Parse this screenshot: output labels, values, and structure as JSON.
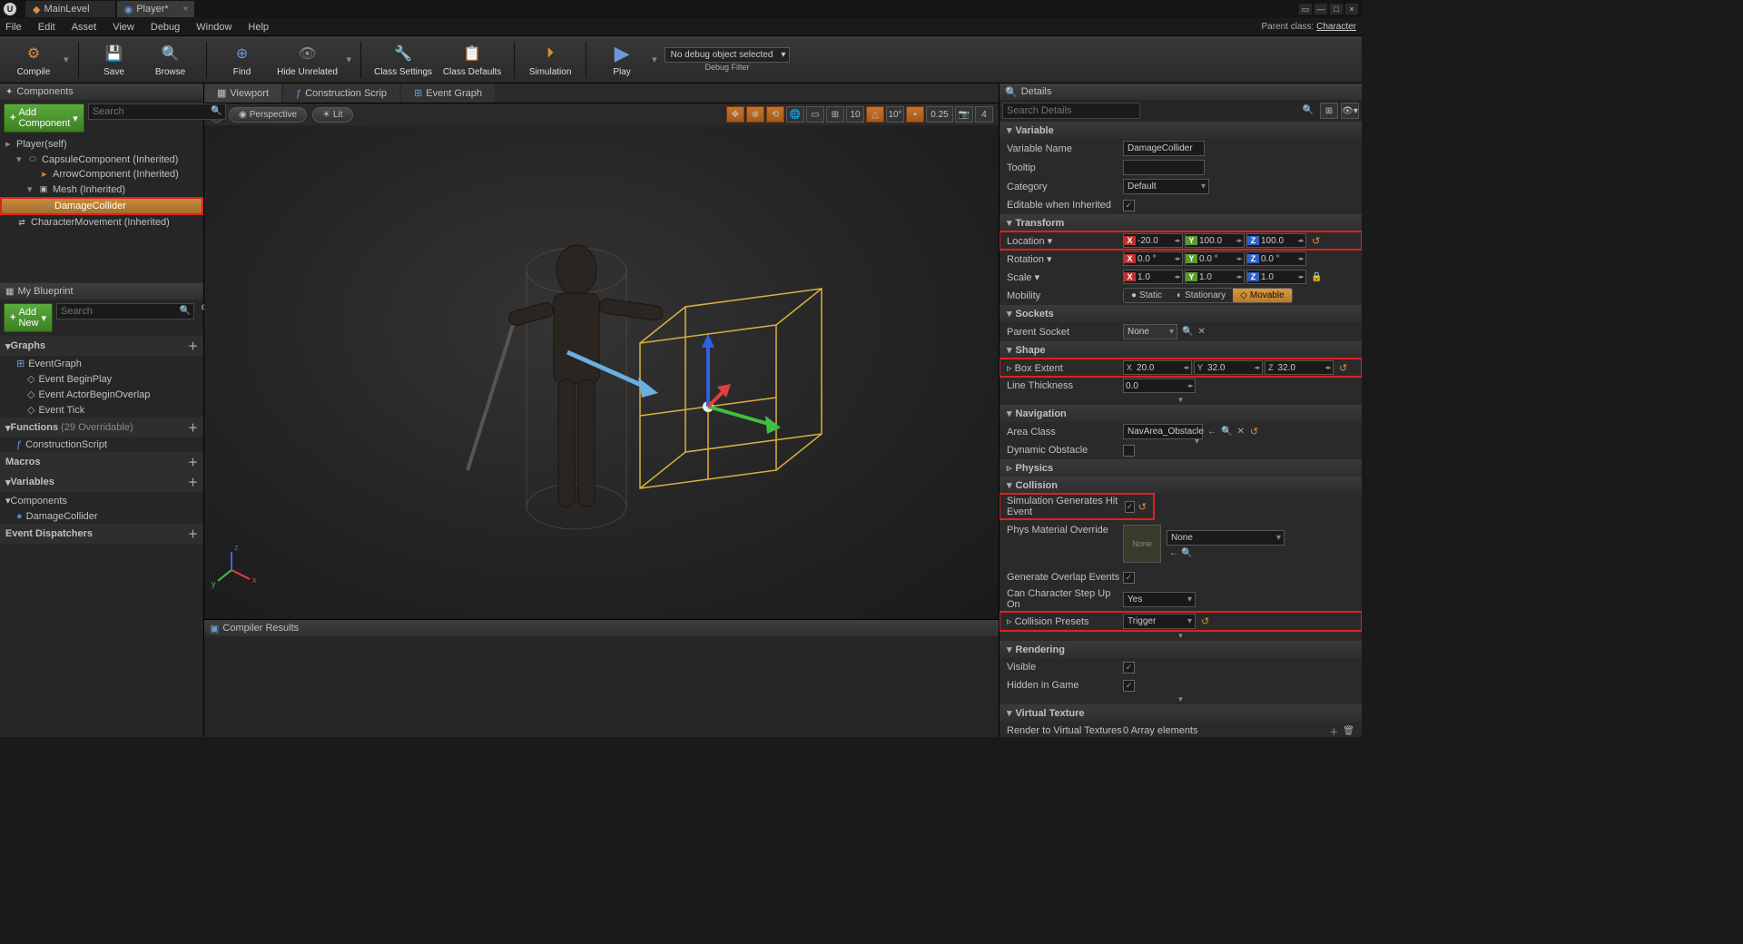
{
  "titlebar": {
    "tabs": [
      {
        "label": "MainLevel",
        "active": false
      },
      {
        "label": "Player*",
        "active": true
      }
    ]
  },
  "menubar": {
    "items": [
      "File",
      "Edit",
      "Asset",
      "View",
      "Debug",
      "Window",
      "Help"
    ],
    "parentClassLabel": "Parent class:",
    "parentClass": "Character"
  },
  "toolbar": {
    "compile": "Compile",
    "save": "Save",
    "browse": "Browse",
    "find": "Find",
    "hideUnrelated": "Hide Unrelated",
    "classSettings": "Class Settings",
    "classDefaults": "Class Defaults",
    "simulation": "Simulation",
    "play": "Play",
    "debugCombo": "No debug object selected",
    "debugFilter": "Debug Filter"
  },
  "components": {
    "title": "Components",
    "addBtn": "Add Component",
    "searchPlaceholder": "Search",
    "root": "Player(self)",
    "items": [
      {
        "label": "CapsuleComponent (Inherited)",
        "indent": 1,
        "caret": "▾",
        "ico": "pill-cyan"
      },
      {
        "label": "ArrowComponent (Inherited)",
        "indent": 2,
        "caret": "",
        "ico": "pill-orange"
      },
      {
        "label": "Mesh (Inherited)",
        "indent": 2,
        "caret": "▾",
        "ico": ""
      },
      {
        "label": "DamageCollider",
        "indent": 3,
        "caret": "",
        "ico": "",
        "selected": true,
        "red": true
      },
      {
        "label": "CharacterMovement (Inherited)",
        "indent": 1,
        "caret": "",
        "ico": ""
      }
    ]
  },
  "myBlueprint": {
    "title": "My Blueprint",
    "addNew": "Add New",
    "searchPlaceholder": "Search",
    "graphs": {
      "label": "Graphs"
    },
    "eventGraph": "EventGraph",
    "events": [
      "Event BeginPlay",
      "Event ActorBeginOverlap",
      "Event Tick"
    ],
    "functions": {
      "label": "Functions",
      "hint": "(29 Overridable)"
    },
    "constructionScript": "ConstructionScript",
    "macros": "Macros",
    "variables": "Variables",
    "componentsSection": "Components",
    "damageCollider": "DamageCollider",
    "eventDispatchers": "Event Dispatchers"
  },
  "centerTabs": {
    "viewport": "Viewport",
    "construction": "Construction Scrip",
    "eventGraph": "Event Graph"
  },
  "viewportBar": {
    "perspective": "Perspective",
    "lit": "Lit",
    "grid": "10",
    "angle": "10°",
    "scale": "0.25",
    "cam": "4"
  },
  "compiler": {
    "title": "Compiler Results"
  },
  "details": {
    "title": "Details",
    "searchPlaceholder": "Search Details",
    "variable": {
      "section": "Variable",
      "name": {
        "label": "Variable Name",
        "value": "DamageCollider"
      },
      "tooltip": {
        "label": "Tooltip",
        "value": ""
      },
      "category": {
        "label": "Category",
        "value": "Default"
      },
      "editable": {
        "label": "Editable when Inherited",
        "checked": true
      }
    },
    "transform": {
      "section": "Transform",
      "location": {
        "label": "Location",
        "x": "-20.0",
        "y": "100.0",
        "z": "100.0"
      },
      "rotation": {
        "label": "Rotation",
        "x": "0.0 °",
        "y": "0.0 °",
        "z": "0.0 °"
      },
      "scale": {
        "label": "Scale",
        "x": "1.0",
        "y": "1.0",
        "z": "1.0"
      },
      "mobility": {
        "label": "Mobility",
        "static": "Static",
        "stationary": "Stationary",
        "movable": "Movable"
      }
    },
    "sockets": {
      "section": "Sockets",
      "parentSocket": {
        "label": "Parent Socket",
        "value": "None"
      }
    },
    "shape": {
      "section": "Shape",
      "boxExtent": {
        "label": "Box Extent",
        "x": "20.0",
        "y": "32.0",
        "z": "32.0"
      },
      "lineThickness": {
        "label": "Line Thickness",
        "value": "0.0"
      }
    },
    "navigation": {
      "section": "Navigation",
      "areaClass": {
        "label": "Area Class",
        "value": "NavArea_Obstacle"
      },
      "dynamic": {
        "label": "Dynamic Obstacle",
        "checked": false
      }
    },
    "physics": {
      "section": "Physics"
    },
    "collision": {
      "section": "Collision",
      "simHit": {
        "label": "Simulation Generates Hit Event",
        "checked": true
      },
      "physMat": {
        "label": "Phys Material Override",
        "thumb": "None",
        "value": "None"
      },
      "overlap": {
        "label": "Generate Overlap Events",
        "checked": true
      },
      "stepUp": {
        "label": "Can Character Step Up On",
        "value": "Yes"
      },
      "presets": {
        "label": "Collision Presets",
        "value": "Trigger"
      }
    },
    "rendering": {
      "section": "Rendering",
      "visible": {
        "label": "Visible",
        "checked": true
      },
      "hidden": {
        "label": "Hidden in Game",
        "checked": true
      }
    },
    "virtualTexture": {
      "section": "Virtual Texture",
      "render": {
        "label": "Render to Virtual Textures",
        "value": "0 Array elements"
      }
    }
  }
}
